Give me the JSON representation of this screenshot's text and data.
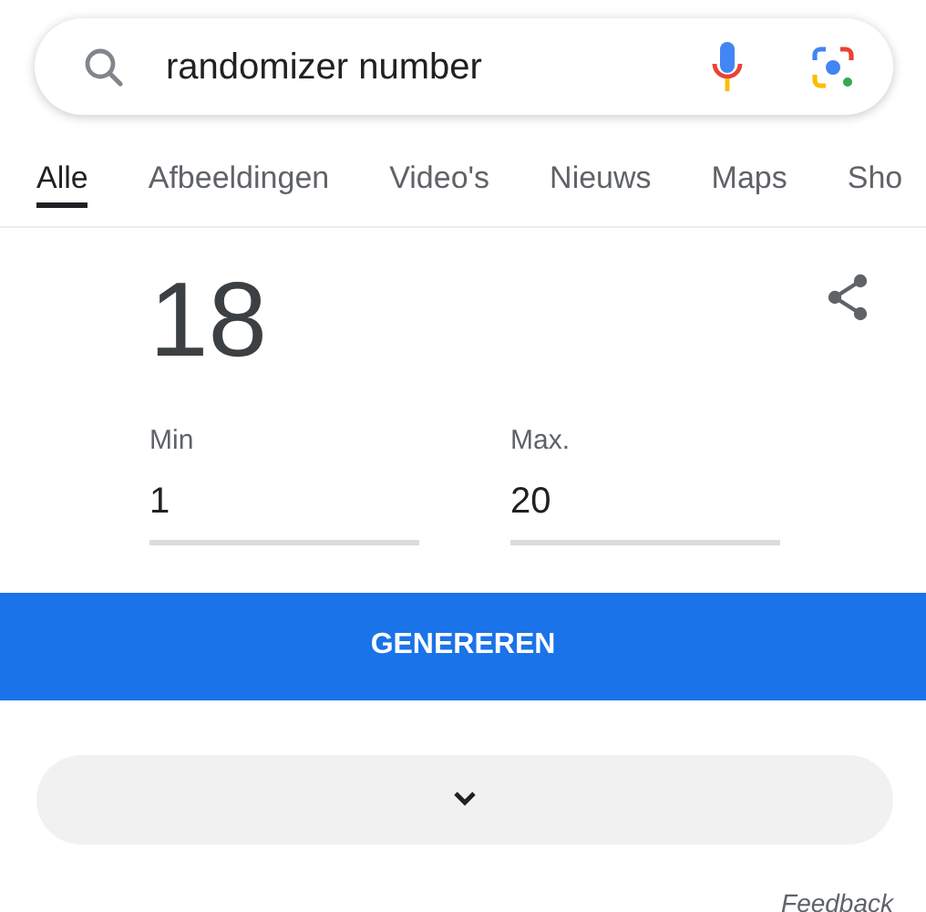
{
  "search": {
    "query": "randomizer number"
  },
  "tabs": [
    {
      "label": "Alle",
      "selected": true
    },
    {
      "label": "Afbeeldingen",
      "selected": false
    },
    {
      "label": "Video's",
      "selected": false
    },
    {
      "label": "Nieuws",
      "selected": false
    },
    {
      "label": "Maps",
      "selected": false
    },
    {
      "label": "Sho",
      "selected": false
    }
  ],
  "result": {
    "number": "18",
    "min": {
      "label": "Min",
      "value": "1"
    },
    "max": {
      "label": "Max.",
      "value": "20"
    },
    "button": "GENEREREN"
  },
  "feedback": "Feedback"
}
